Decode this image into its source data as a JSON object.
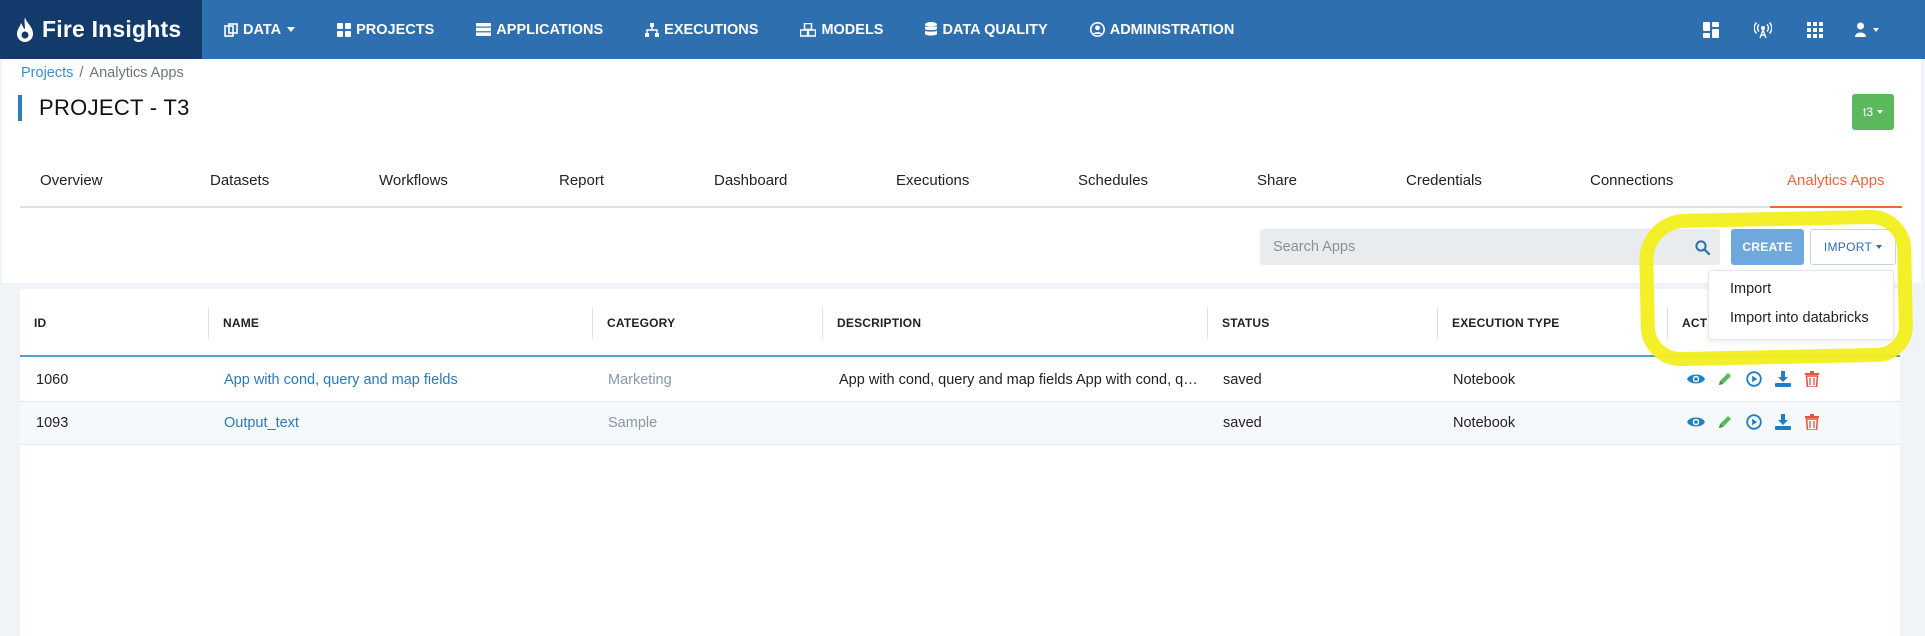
{
  "app": {
    "brand": "Fire Insights",
    "brand_icon": "flame-icon",
    "colors": {
      "navbar": "#2e6fb0",
      "brand_bg": "#123b6b",
      "accent_tab": "#f0643c",
      "badge": "#5cb85c",
      "create_btn": "#6fa8dc",
      "highlight": "#f2ef1d"
    }
  },
  "navbar": {
    "items": [
      {
        "label": "DATA",
        "icon": "data-icon",
        "dropdown": true
      },
      {
        "label": "PROJECTS",
        "icon": "grid-icon"
      },
      {
        "label": "APPLICATIONS",
        "icon": "server-icon"
      },
      {
        "label": "EXECUTIONS",
        "icon": "sitemap-icon"
      },
      {
        "label": "MODELS",
        "icon": "cubes-icon"
      },
      {
        "label": "DATA QUALITY",
        "icon": "database-icon"
      },
      {
        "label": "ADMINISTRATION",
        "icon": "user-circle-icon"
      }
    ],
    "right_icons": [
      "dashboard-icon",
      "broadcast-icon",
      "apps-grid-icon",
      "user-menu-icon"
    ]
  },
  "breadcrumb": {
    "root": "Projects",
    "separator": "/",
    "current": "Analytics Apps"
  },
  "project": {
    "title": "PROJECT - T3",
    "user_badge": "t3"
  },
  "tabs": [
    {
      "label": "Overview"
    },
    {
      "label": "Datasets"
    },
    {
      "label": "Workflows"
    },
    {
      "label": "Report"
    },
    {
      "label": "Dashboard"
    },
    {
      "label": "Executions"
    },
    {
      "label": "Schedules"
    },
    {
      "label": "Share"
    },
    {
      "label": "Credentials"
    },
    {
      "label": "Connections"
    },
    {
      "label": "Analytics Apps",
      "active": true
    }
  ],
  "toolbar": {
    "search_placeholder": "Search Apps",
    "create_label": "CREATE",
    "import_label": "IMPORT"
  },
  "import_menu": {
    "items": [
      "Import",
      "Import into databricks"
    ]
  },
  "table": {
    "columns": [
      "ID",
      "NAME",
      "CATEGORY",
      "DESCRIPTION",
      "STATUS",
      "EXECUTION TYPE",
      "ACTIONS"
    ],
    "rows": [
      {
        "id": "1060",
        "name": "App with cond, query and map fields",
        "category": "Marketing",
        "description": "App with cond, query and map fields App with cond, query and map fields",
        "status": "saved",
        "execution_type": "Notebook"
      },
      {
        "id": "1093",
        "name": "Output_text",
        "category": "Sample",
        "description": "",
        "status": "saved",
        "execution_type": "Notebook"
      }
    ],
    "row_actions": [
      "view-icon",
      "edit-icon",
      "run-icon",
      "download-icon",
      "delete-icon"
    ]
  }
}
